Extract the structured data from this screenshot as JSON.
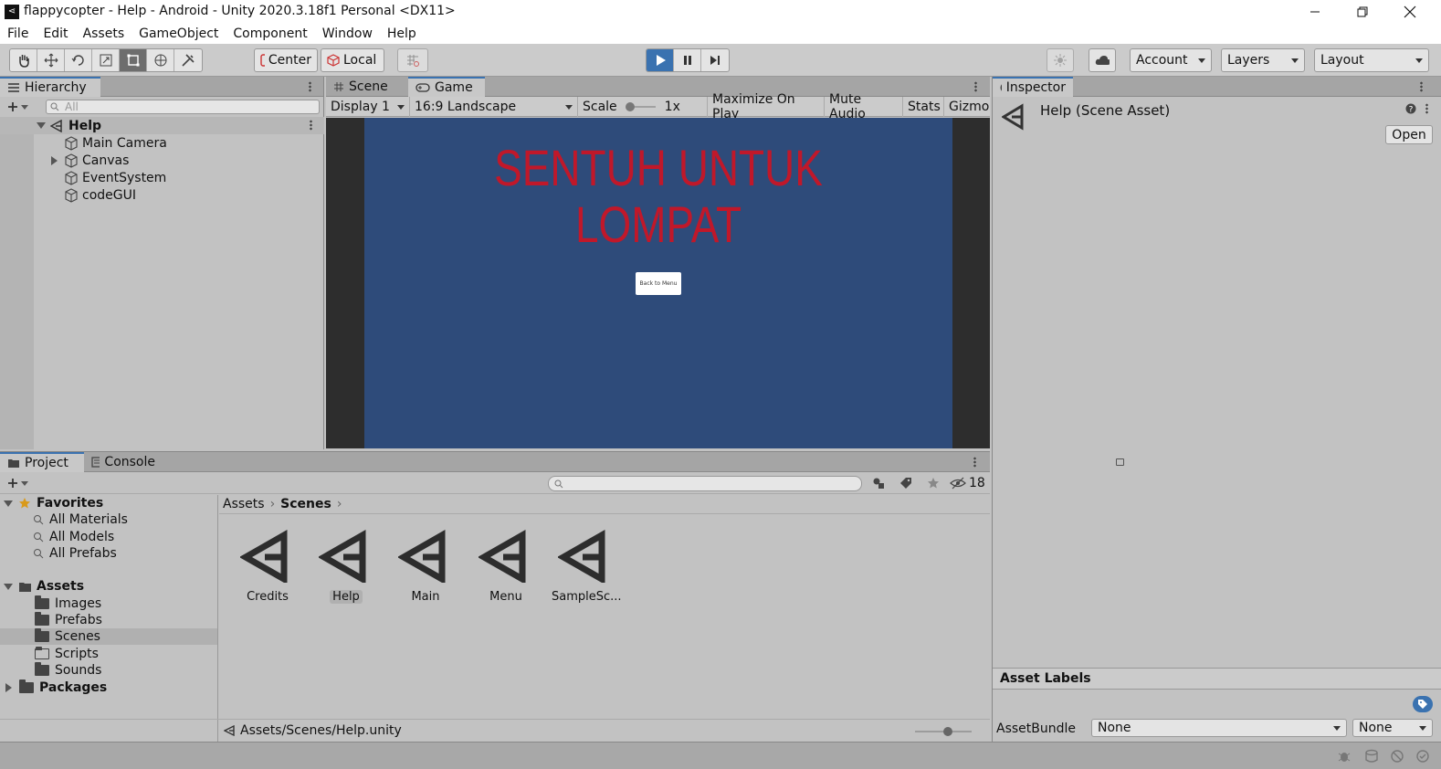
{
  "window": {
    "title": "flappycopter - Help - Android - Unity 2020.3.18f1 Personal <DX11>",
    "app_icon_glyph": "⋖"
  },
  "menu": [
    "File",
    "Edit",
    "Assets",
    "GameObject",
    "Component",
    "Window",
    "Help"
  ],
  "toolbar": {
    "pivot_label": "Center",
    "space_label": "Local",
    "account_label": "Account",
    "layers_label": "Layers",
    "layout_label": "Layout"
  },
  "hierarchy": {
    "tab_label": "Hierarchy",
    "search_placeholder": "All",
    "scene_name": "Help",
    "items": [
      "Main Camera",
      "Canvas",
      "EventSystem",
      "codeGUI"
    ]
  },
  "center_tabs": {
    "scene": "Scene",
    "game": "Game"
  },
  "game_bar": {
    "display": "Display 1",
    "aspect": "16:9 Landscape",
    "scale_label": "Scale",
    "scale_value": "1x",
    "maximize": "Maximize On Play",
    "mute": "Mute Audio",
    "stats": "Stats",
    "gizmos": "Gizmos"
  },
  "game": {
    "headline_line1": "SENTUH UNTUK",
    "headline_line2": "LOMPAT",
    "button_label": "Back to Menu",
    "headline_color": "#c0182a",
    "background_color": "#2e4b7a"
  },
  "inspector": {
    "tab_label": "Inspector",
    "asset_title": "Help (Scene Asset)",
    "open_button": "Open",
    "asset_labels": "Asset Labels",
    "assetbundle_label": "AssetBundle",
    "assetbundle_value": "None",
    "variant_value": "None"
  },
  "project": {
    "tab_project": "Project",
    "tab_console": "Console",
    "hidden_count": "18",
    "favorites_label": "Favorites",
    "favorites": [
      "All Materials",
      "All Models",
      "All Prefabs"
    ],
    "assets_label": "Assets",
    "asset_folders": [
      "Images",
      "Prefabs",
      "Scenes",
      "Scripts",
      "Sounds"
    ],
    "packages_label": "Packages",
    "breadcrumb_root": "Assets",
    "breadcrumb_current": "Scenes",
    "scene_assets": [
      "Credits",
      "Help",
      "Main",
      "Menu",
      "SampleSc..."
    ],
    "selected_path": "Assets/Scenes/Help.unity"
  }
}
